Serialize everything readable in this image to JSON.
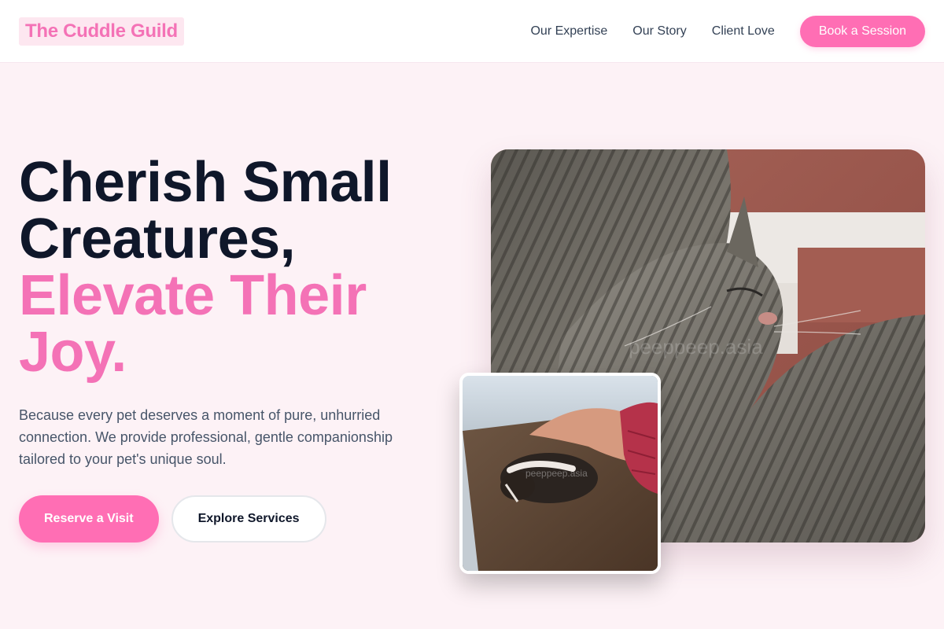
{
  "brand": {
    "name": "The Cuddle Guild"
  },
  "nav": {
    "links": [
      "Our Expertise",
      "Our Story",
      "Client Love"
    ],
    "cta": "Book a Session"
  },
  "hero": {
    "headline_line1": "Cherish Small",
    "headline_line2": "Creatures,",
    "headline_accent1": "Elevate Their",
    "headline_accent2": "Joy.",
    "subtext": "Because every pet deserves a moment of pure, unhurried connection. We provide professional, gentle companionship tailored to your pet's unique soul.",
    "primary_button": "Reserve a Visit",
    "secondary_button": "Explore Services"
  },
  "images": {
    "main_watermark": "peeppeep.asia",
    "inset_watermark": "peeppeep.asia"
  },
  "colors": {
    "accent": "#f472b6",
    "button": "#ff6eb4",
    "background": "#fdf2f6",
    "heading": "#0f172a",
    "body_text": "#475569"
  }
}
